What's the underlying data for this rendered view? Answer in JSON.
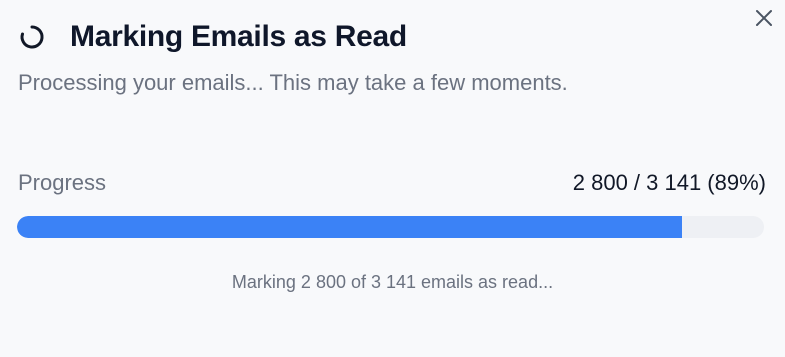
{
  "dialog": {
    "title": "Marking Emails as Read",
    "subtitle": "Processing your emails... This may take a few moments.",
    "close_icon": "close-icon",
    "spinner_icon": "loading-spinner-icon"
  },
  "progress": {
    "label": "Progress",
    "count_text": "2 800 / 3 141 (89%)",
    "processed": 2800,
    "total": 3141,
    "fraction": 0.89,
    "fill_color": "#3b82f6",
    "track_color": "#eef0f4"
  },
  "status": {
    "text": "Marking 2 800 of 3 141 emails as read..."
  }
}
